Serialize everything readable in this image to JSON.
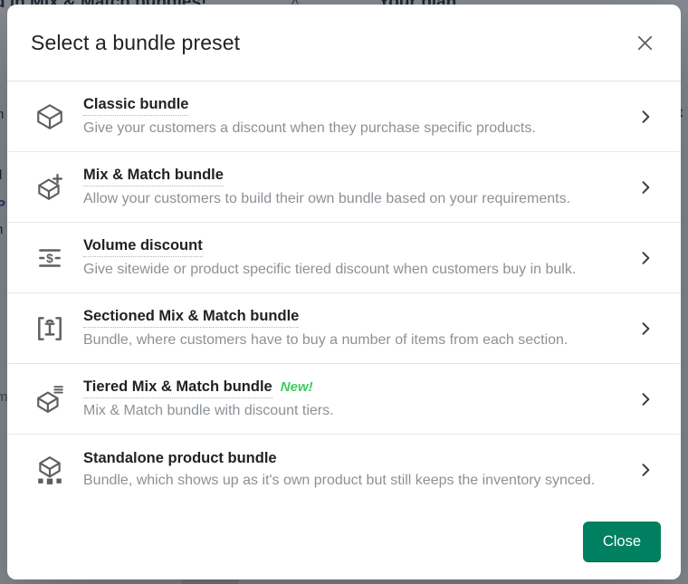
{
  "background": {
    "banner_title": "d in Mix & Match bundles!",
    "banner_collapse_icon": "chevron-up-icon",
    "plan_title": "Your plan",
    "left_fragments": [
      "n",
      "d",
      "P",
      "n",
      "m"
    ],
    "right_fragment": "it"
  },
  "modal": {
    "title": "Select a bundle preset",
    "close_icon": "close-x-icon",
    "presets": [
      {
        "icon": "cube-icon",
        "title": "Classic bundle",
        "dotted_underline": true,
        "badge": "",
        "description": "Give your customers a discount when they purchase specific products.",
        "chevron": "chevron-right-icon"
      },
      {
        "icon": "cube-plus-icon",
        "title": "Mix & Match bundle",
        "dotted_underline": true,
        "badge": "",
        "description": "Allow your customers to build their own bundle based on your requirements.",
        "chevron": "chevron-right-icon"
      },
      {
        "icon": "dollar-tiers-icon",
        "title": "Volume discount",
        "dotted_underline": true,
        "badge": "",
        "description": "Give sitewide or product specific tiered discount when customers buy in bulk.",
        "chevron": "chevron-right-icon"
      },
      {
        "icon": "bracketed-column-icon",
        "title": "Sectioned Mix & Match bundle",
        "dotted_underline": true,
        "badge": "",
        "description": "Bundle, where customers have to buy a number of items from each section.",
        "chevron": "chevron-right-icon"
      },
      {
        "icon": "cube-list-icon",
        "title": "Tiered Mix & Match bundle",
        "dotted_underline": true,
        "badge": "New!",
        "description": "Mix & Match bundle with discount tiers.",
        "chevron": "chevron-right-icon"
      },
      {
        "icon": "cube-squares-icon",
        "title": "Standalone product bundle",
        "dotted_underline": false,
        "badge": "",
        "description": "Bundle, which shows up as it's own product but still keeps the inventory synced.",
        "chevron": "chevron-right-icon"
      }
    ],
    "footer": {
      "close_label": "Close"
    }
  },
  "colors": {
    "primary_button": "#008060",
    "badge_green": "#3ecc5f",
    "title_text": "#202223",
    "description_text": "#8c9196",
    "icon": "#5c5f62"
  }
}
